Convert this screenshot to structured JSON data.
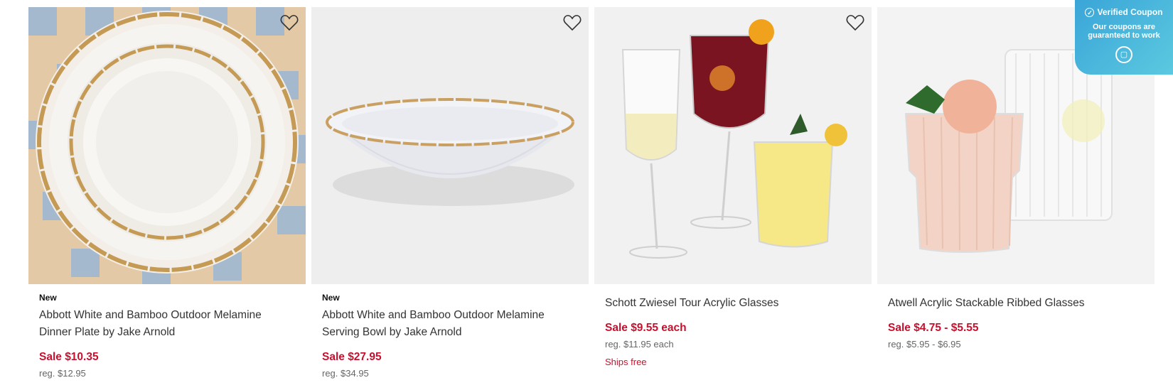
{
  "products": [
    {
      "badge": "New",
      "title_line1": "Abbott White and Bamboo Outdoor Melamine",
      "title_line2": "Dinner Plate by Jake Arnold",
      "sale_price": "Sale $10.35",
      "reg_price": "reg. $12.95",
      "ships": ""
    },
    {
      "badge": "New",
      "title_line1": "Abbott White and Bamboo Outdoor Melamine",
      "title_line2": "Serving Bowl by Jake Arnold",
      "sale_price": "Sale $27.95",
      "reg_price": "reg. $34.95",
      "ships": ""
    },
    {
      "badge": "",
      "title_line1": "Schott Zwiesel Tour Acrylic Glasses",
      "title_line2": "",
      "sale_price": "Sale $9.55 each",
      "reg_price": "reg. $11.95 each",
      "ships": "Ships free"
    },
    {
      "badge": "",
      "title_line1": "Atwell Acrylic Stackable Ribbed Glasses",
      "title_line2": "",
      "sale_price": "Sale $4.75 - $5.55",
      "reg_price": "reg. $5.95 - $6.95",
      "ships": ""
    }
  ],
  "coupon": {
    "title": "Verified Coupon",
    "subtitle": "Our coupons are guaranteed to work",
    "check_icon": "check-circle-icon",
    "chat_icon": "chat-bubble-icon"
  },
  "icons": {
    "favorite": "heart-outline-icon"
  },
  "colors": {
    "sale": "#c8102e",
    "coupon": "#3aa5d8"
  }
}
